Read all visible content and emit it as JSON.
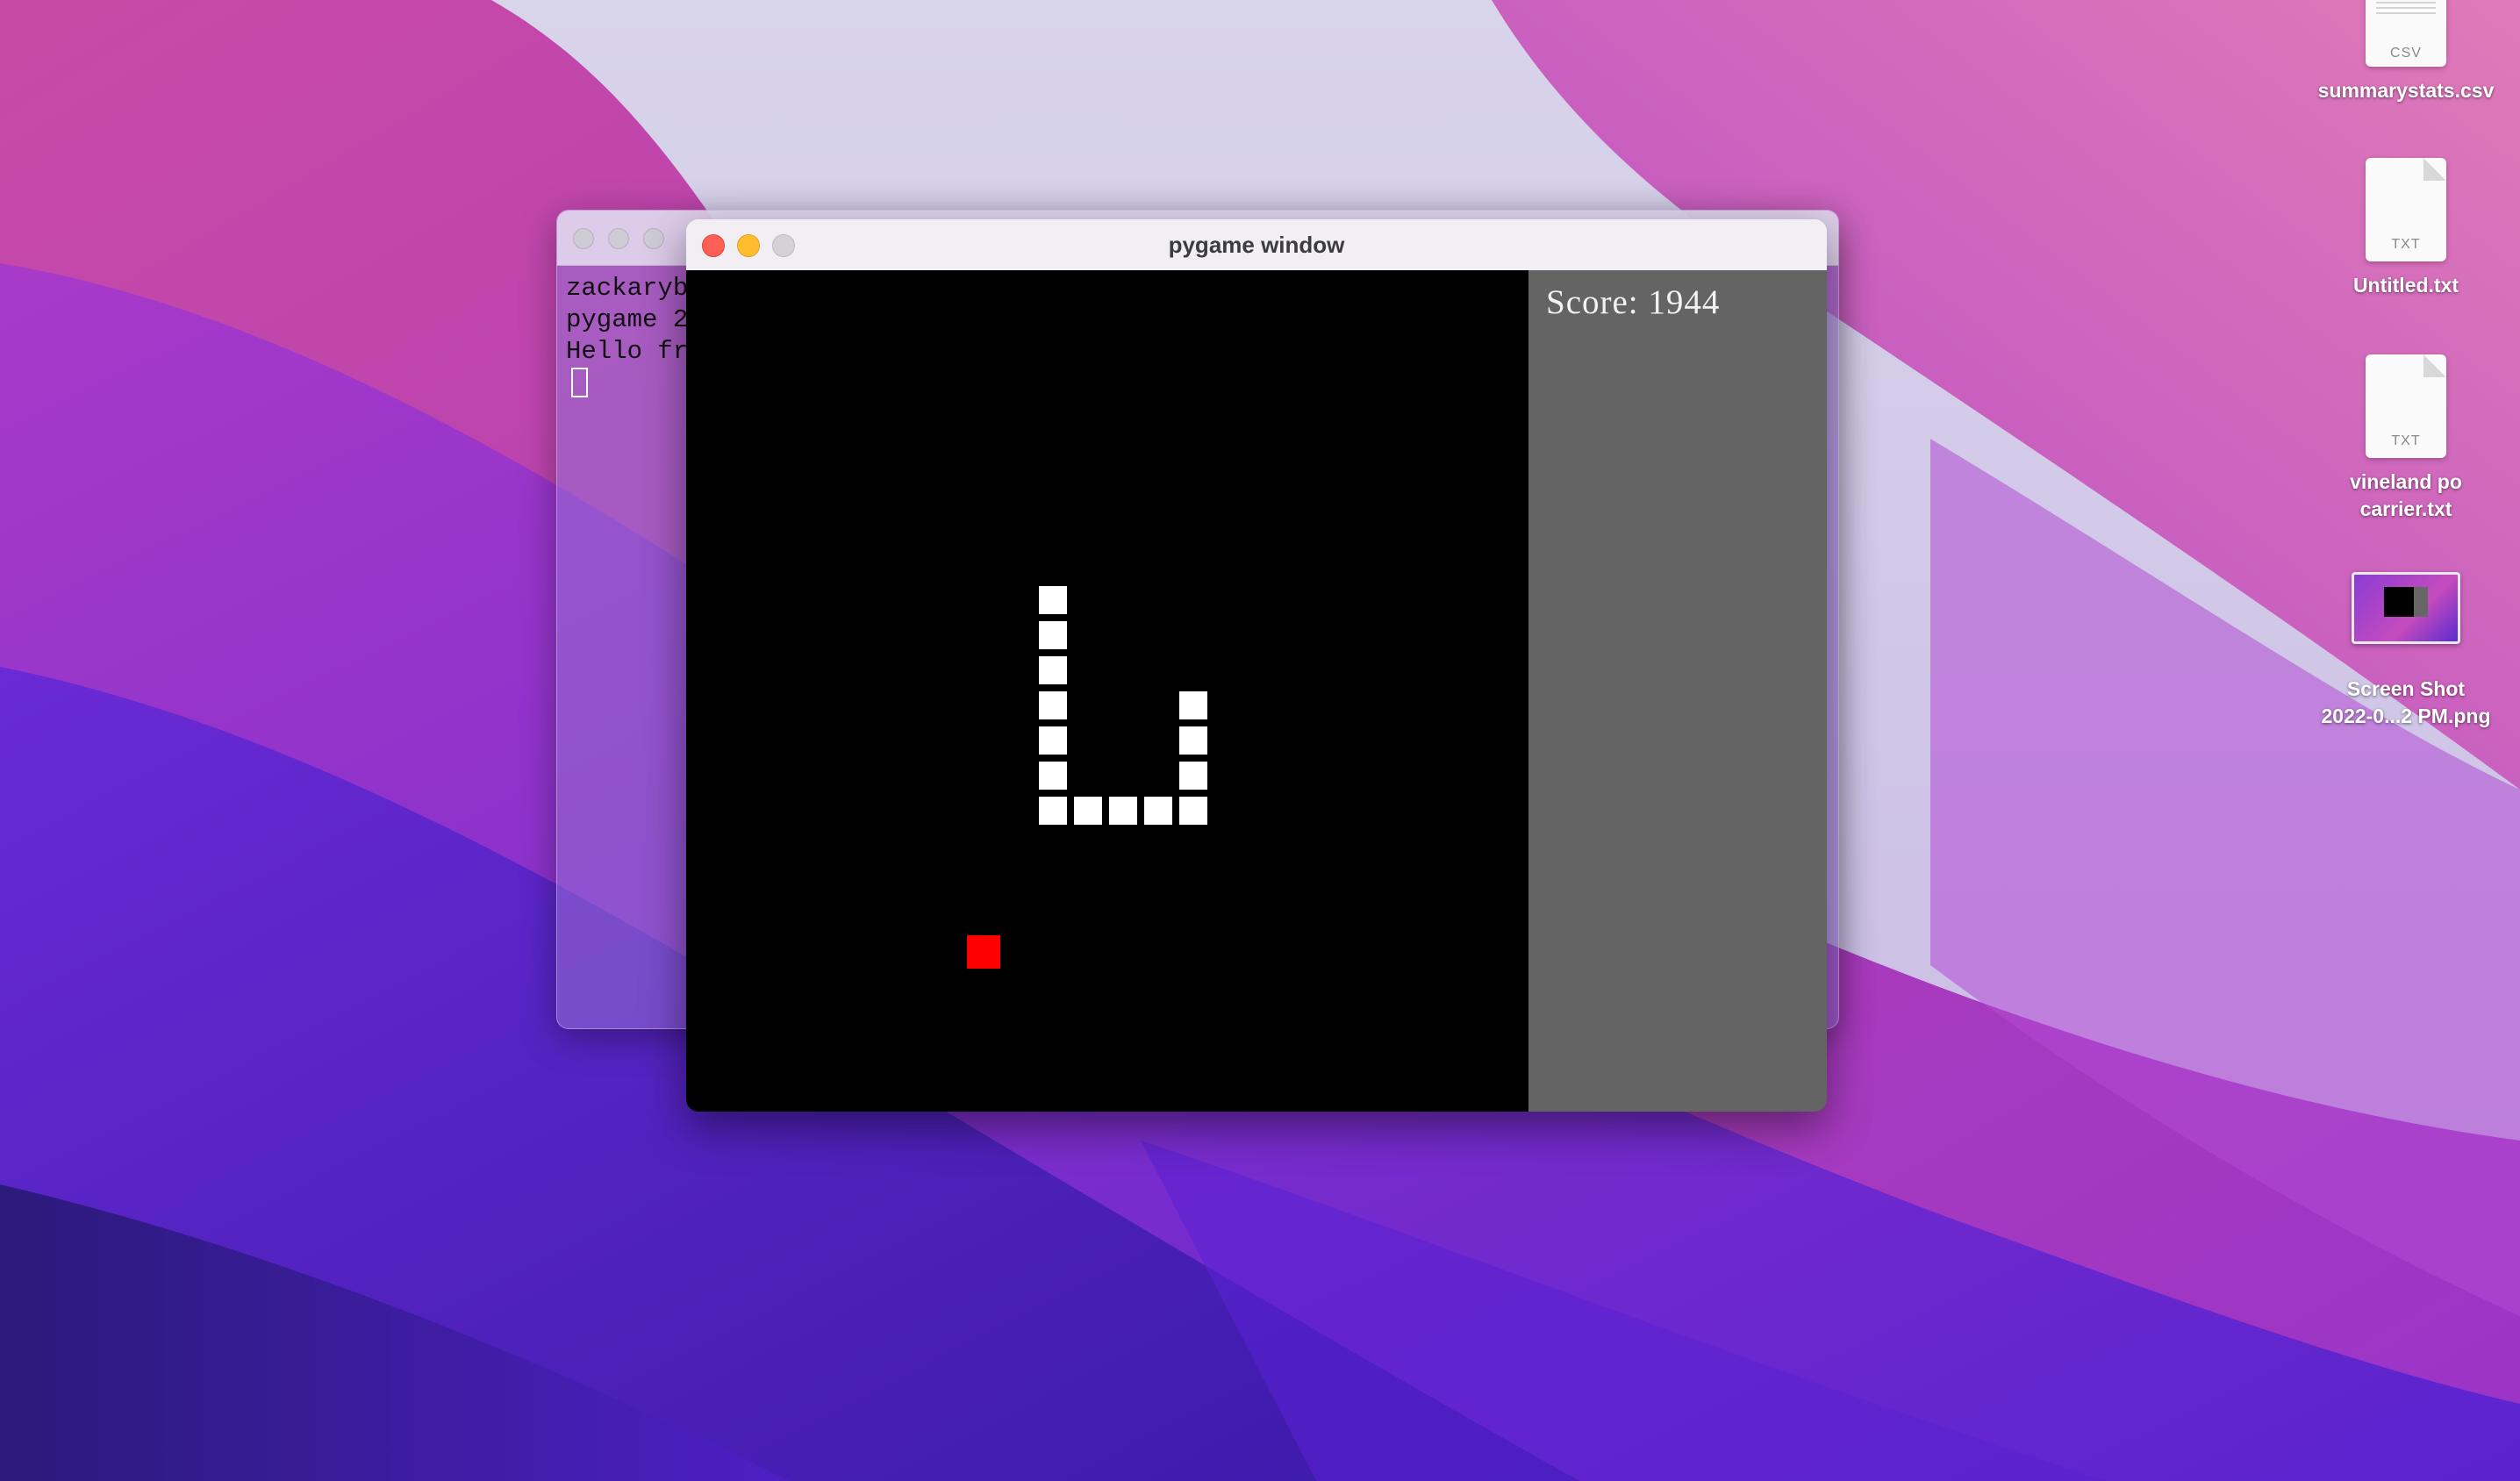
{
  "desktop": {
    "icons": [
      {
        "label": "summarystats.csv",
        "type": "CSV"
      },
      {
        "label": "Untitled.txt",
        "type": "TXT"
      },
      {
        "label_line1": "vineland po",
        "label_line2": "carrier.txt",
        "type": "TXT"
      },
      {
        "label_line1": "Screen Shot",
        "label_line2": "2022-0...2 PM.png",
        "type": "PNG"
      }
    ]
  },
  "terminal": {
    "lines": [
      "zackaryb",
      "pygame 2",
      "Hello fr"
    ]
  },
  "pygame_window": {
    "title": "pygame window",
    "score_text": "Score: 1944",
    "colors": {
      "playfield": "#000000",
      "side_panel": "#646464",
      "snake": "#ffffff",
      "food": "#ff0000",
      "close": "#ff5f57",
      "minimize": "#febc2e",
      "zoom_inactive": "#d4d2d6"
    }
  }
}
